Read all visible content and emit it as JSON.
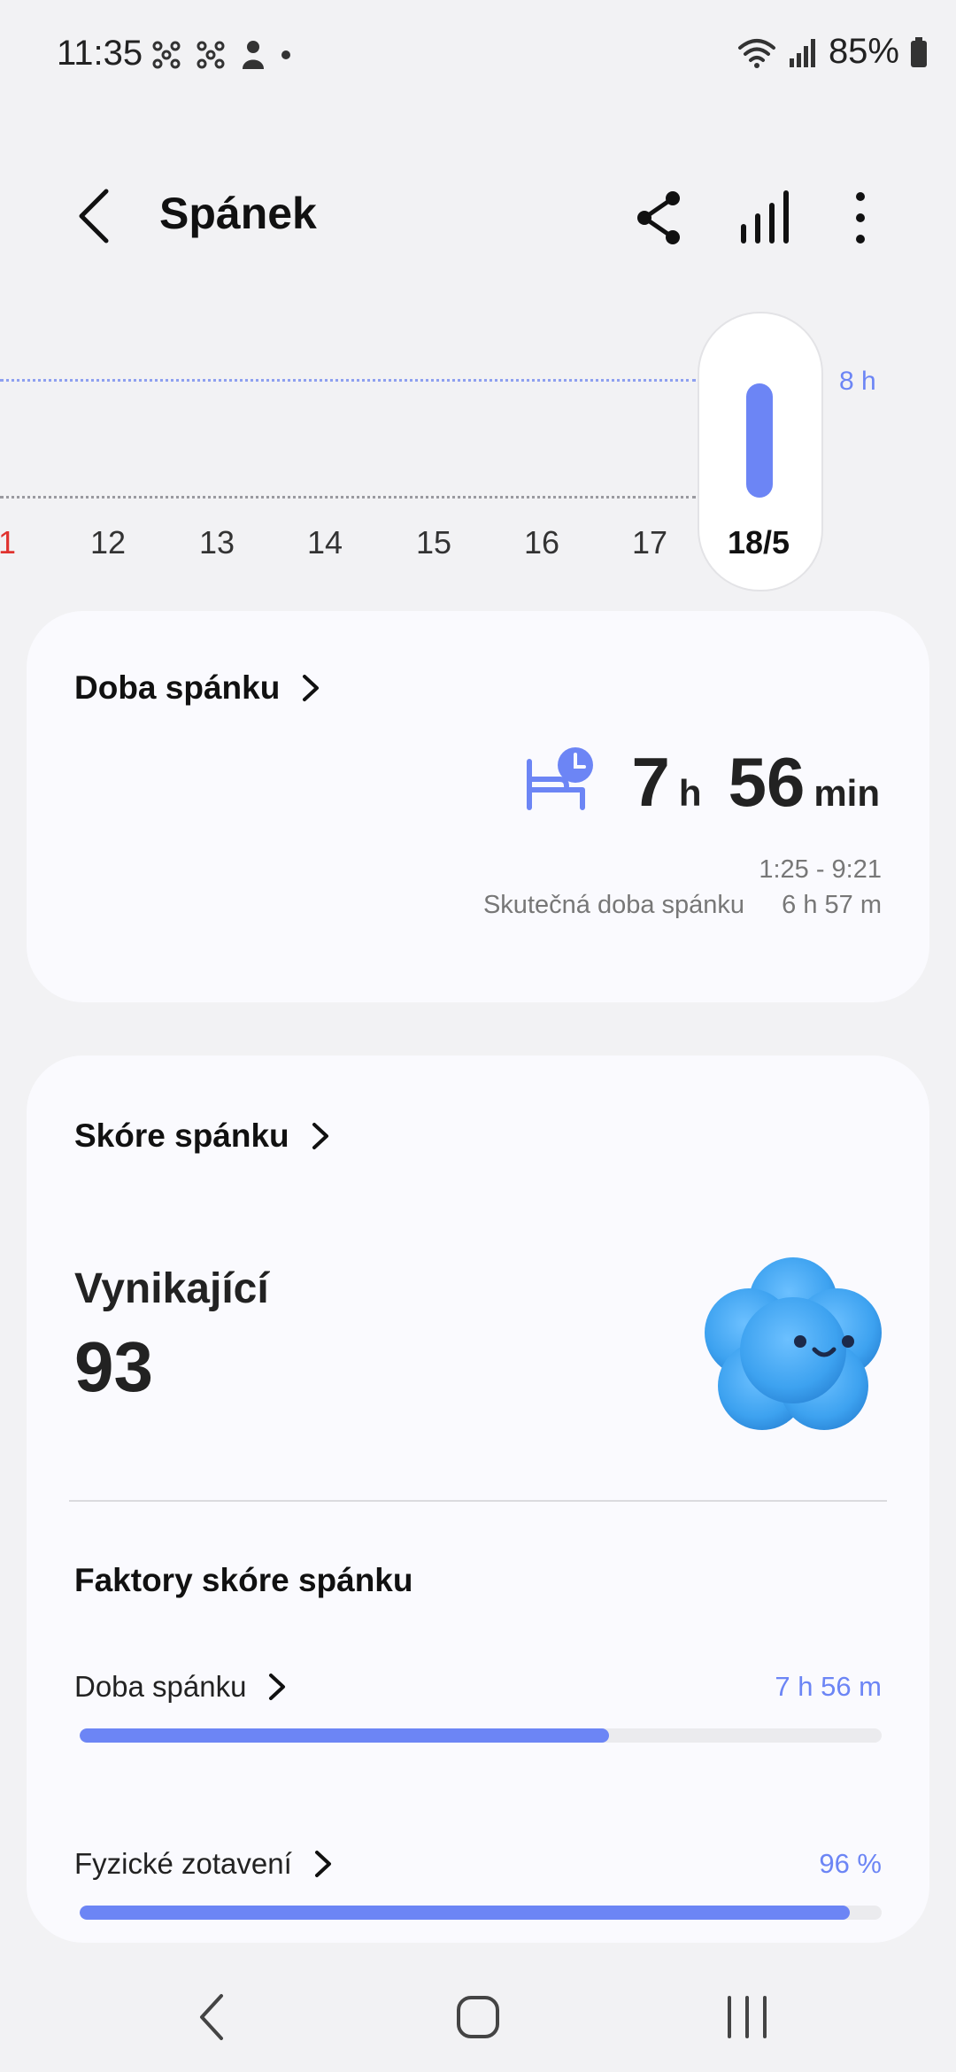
{
  "status_bar": {
    "time": "11:35",
    "battery": "85%"
  },
  "header": {
    "title": "Spánek"
  },
  "chart": {
    "days": [
      "1",
      "12",
      "13",
      "14",
      "15",
      "16",
      "17"
    ],
    "selected_day": "18/5",
    "goal_label": "8 h",
    "selected_sleep_hours": 7.93,
    "goal_hours": 8
  },
  "sleep_time_card": {
    "title": "Doba spánku",
    "hours": "7",
    "hours_unit": "h",
    "minutes": "56",
    "minutes_unit": "min",
    "range": "1:25 - 9:21",
    "actual_label": "Skutečná doba spánku",
    "actual_value": "6 h 57 m"
  },
  "sleep_score_card": {
    "title": "Skóre spánku",
    "rating": "Vynikající",
    "score": "93",
    "factors_title": "Faktory skóre spánku",
    "factors": [
      {
        "label": "Doba spánku",
        "value": "7 h 56 m",
        "progress": 0.66
      },
      {
        "label": "Fyzické zotavení",
        "value": "96 %",
        "progress": 0.96
      }
    ]
  },
  "colors": {
    "accent": "#6c85f5",
    "background": "#f2f2f4",
    "card": "#fafafe",
    "highlight_day": "#e0332f",
    "mascot": "#3da2f0"
  }
}
